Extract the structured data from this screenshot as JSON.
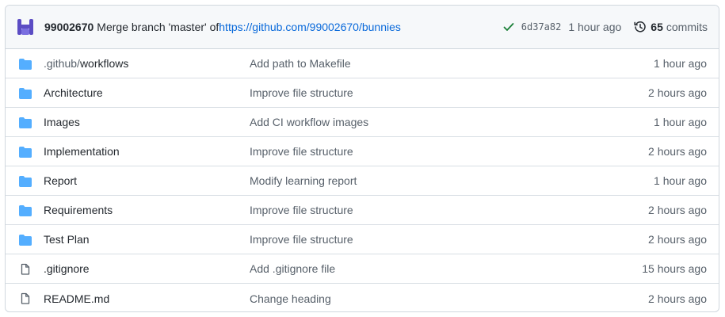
{
  "latest_commit": {
    "author": "99002670",
    "message_prefix": "Merge branch 'master' of ",
    "message_link": "https://github.com/99002670/bunnies",
    "sha": "6d37a82",
    "time_ago": "1 hour ago",
    "commit_count": "65",
    "commits_label": "commits",
    "status_icon": "check-icon",
    "history_icon": "history-icon"
  },
  "files": [
    {
      "type": "folder",
      "name_dim": ".github/",
      "name": "workflows",
      "message": "Add path to Makefile",
      "age": "1 hour ago"
    },
    {
      "type": "folder",
      "name_dim": "",
      "name": "Architecture",
      "message": "Improve file structure",
      "age": "2 hours ago"
    },
    {
      "type": "folder",
      "name_dim": "",
      "name": "Images",
      "message": "Add CI workflow images",
      "age": "1 hour ago"
    },
    {
      "type": "folder",
      "name_dim": "",
      "name": "Implementation",
      "message": "Improve file structure",
      "age": "2 hours ago"
    },
    {
      "type": "folder",
      "name_dim": "",
      "name": "Report",
      "message": "Modify learning report",
      "age": "1 hour ago"
    },
    {
      "type": "folder",
      "name_dim": "",
      "name": "Requirements",
      "message": "Improve file structure",
      "age": "2 hours ago"
    },
    {
      "type": "folder",
      "name_dim": "",
      "name": "Test Plan",
      "message": "Improve file structure",
      "age": "2 hours ago"
    },
    {
      "type": "file",
      "name_dim": "",
      "name": ".gitignore",
      "message": "Add .gitignore file",
      "age": "15 hours ago"
    },
    {
      "type": "file",
      "name_dim": "",
      "name": "README.md",
      "message": "Change heading",
      "age": "2 hours ago"
    }
  ],
  "colors": {
    "folder": "#54aeff",
    "link": "#0969da",
    "success": "#1a7f37",
    "avatar": "#5b4cc4"
  }
}
